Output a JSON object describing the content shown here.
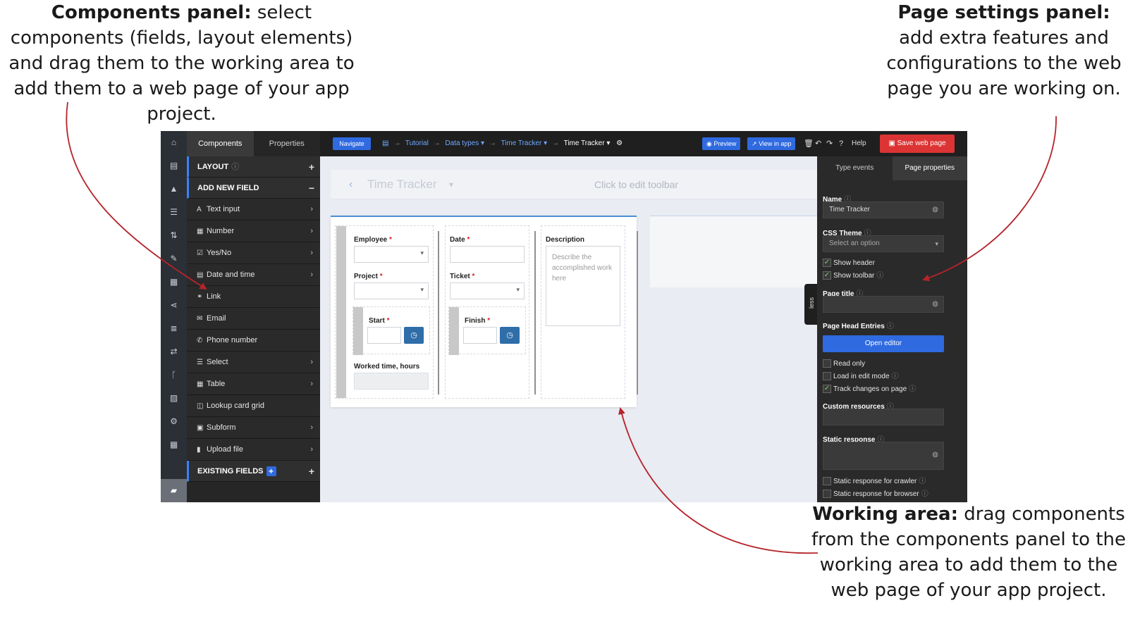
{
  "annotations": {
    "components_title": "Components panel:",
    "components_text": " select components (fields, layout elements) and drag them to the working area to add them to a web page of your app project.",
    "settings_title": "Page settings panel:",
    "settings_text": " add extra features and configurations to the web page you are working on.",
    "working_title": "Working area:",
    "working_text": " drag components from the components panel to the working area to add them to the web page of your app project."
  },
  "topbar": {
    "navigate": "Navigate",
    "breadcrumb": [
      "Tutorial",
      "Data types",
      "Time Tracker",
      "Time Tracker"
    ],
    "preview": "Preview",
    "view_in_app": "View in app",
    "help": "Help",
    "save": "Save web page"
  },
  "left_panel": {
    "tabs": [
      "Components",
      "Properties"
    ],
    "layout_header": "LAYOUT",
    "add_field_header": "ADD NEW FIELD",
    "items": [
      {
        "label": "Text input",
        "icon": "A"
      },
      {
        "label": "Number",
        "icon": "▦"
      },
      {
        "label": "Yes/No",
        "icon": "☑"
      },
      {
        "label": "Date and time",
        "icon": "▤"
      },
      {
        "label": "Link",
        "icon": "⚭"
      },
      {
        "label": "Email",
        "icon": "✉"
      },
      {
        "label": "Phone number",
        "icon": "✆"
      },
      {
        "label": "Select",
        "icon": "☰"
      },
      {
        "label": "Table",
        "icon": "▦"
      },
      {
        "label": "Lookup card grid",
        "icon": "◫"
      },
      {
        "label": "Subform",
        "icon": "▣"
      },
      {
        "label": "Upload file",
        "icon": "▮"
      }
    ],
    "existing_header": "EXISTING FIELDS"
  },
  "toolbar": {
    "title": "Time Tracker",
    "edit_hint": "Click to edit toolbar"
  },
  "form": {
    "employee": "Employee",
    "project": "Project",
    "start": "Start",
    "worked": "Worked time, hours",
    "date": "Date",
    "ticket": "Ticket",
    "finish": "Finish",
    "description": "Description",
    "description_placeholder": "Describe the accomplished work here"
  },
  "less_tab": "less",
  "right_panel": {
    "tabs": [
      "Type events",
      "Page properties"
    ],
    "name_label": "Name",
    "name_value": "Time Tracker",
    "css_theme_label": "CSS Theme",
    "css_theme_placeholder": "Select an option",
    "show_header": "Show header",
    "show_toolbar": "Show toolbar",
    "page_title_label": "Page title",
    "page_head_label": "Page Head Entries",
    "open_editor": "Open editor",
    "read_only": "Read only",
    "load_edit": "Load in edit mode",
    "track_changes": "Track changes on page",
    "custom_resources": "Custom resources",
    "static_response": "Static response",
    "static_crawler": "Static response for crawler",
    "static_browser": "Static response for browser"
  },
  "colors": {
    "accent_blue": "#2f6ae0",
    "save_red": "#dc3434",
    "arrow_red": "#b5242a"
  }
}
